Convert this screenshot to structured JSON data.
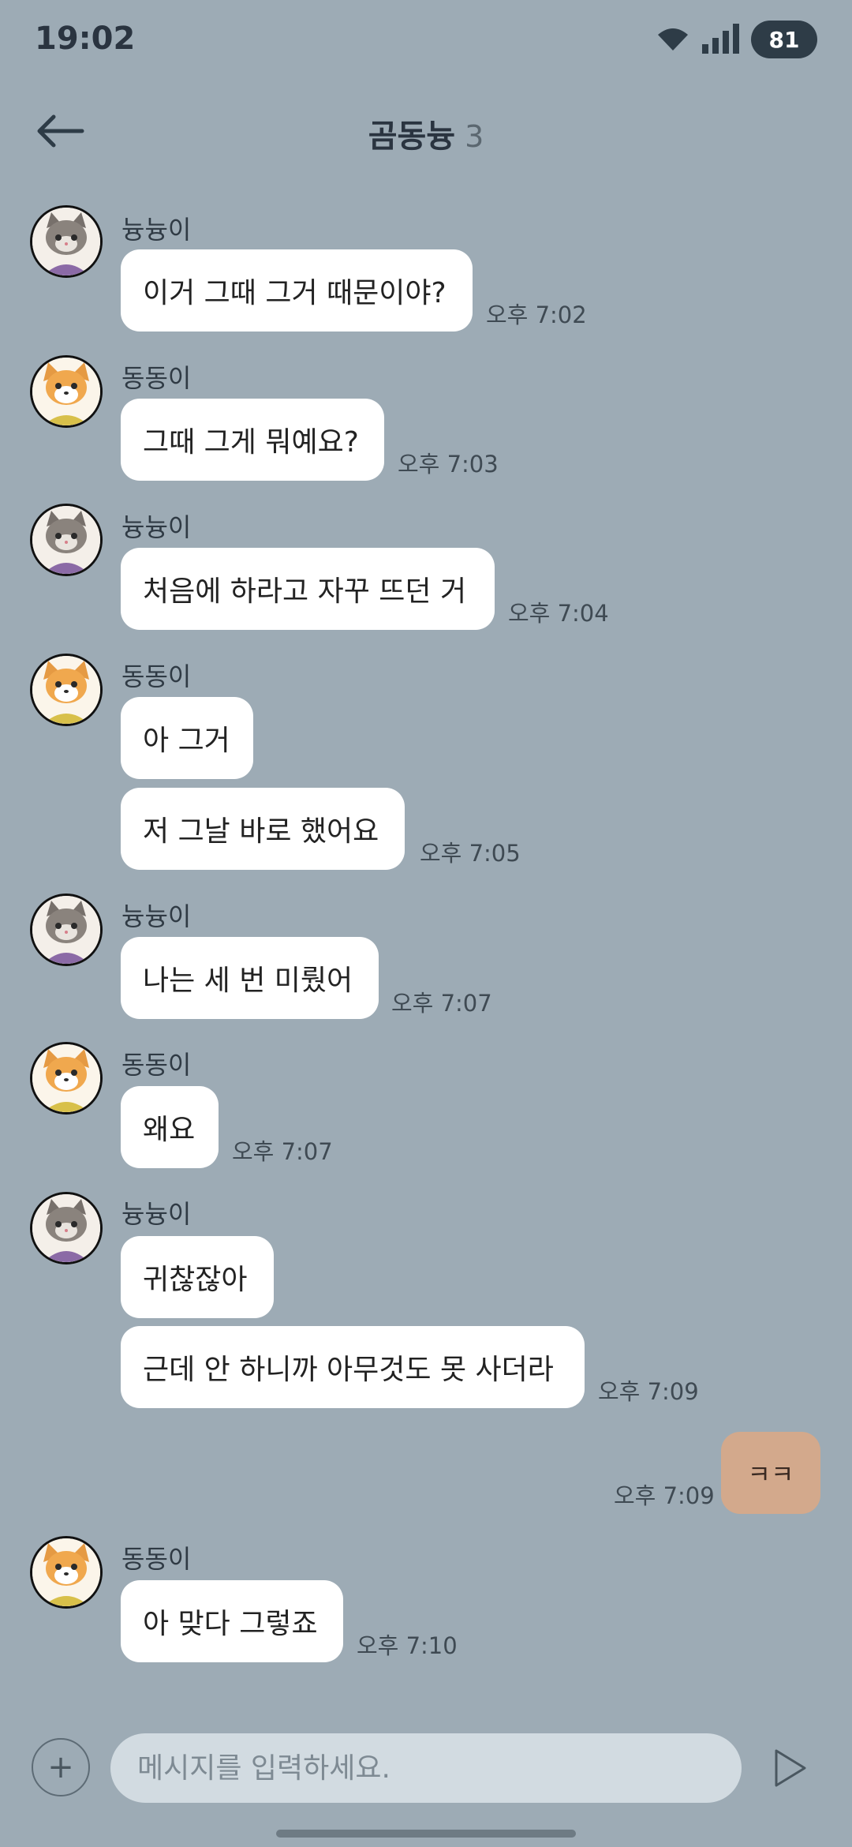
{
  "status": {
    "time": "19:02",
    "battery": "81"
  },
  "header": {
    "title": "곰동늉",
    "member_count": "3"
  },
  "messages": [
    {
      "sender": "늉늉이",
      "text": "이거 그때 그거 때문이야?",
      "time": "오후 7:02"
    },
    {
      "sender": "동동이",
      "text": "그때 그게 뭐예요?",
      "time": "오후 7:03"
    },
    {
      "sender": "늉늉이",
      "text": "처음에 하라고 자꾸 뜨던 거",
      "time": "오후 7:04"
    },
    {
      "sender": "동동이",
      "text": "아 그거"
    },
    {
      "text": "저 그날 바로 했어요",
      "time": "오후 7:05"
    },
    {
      "sender": "늉늉이",
      "text": "나는 세 번 미뤘어",
      "time": "오후 7:07"
    },
    {
      "sender": "동동이",
      "text": "왜요",
      "time": "오후 7:07"
    },
    {
      "sender": "늉늉이",
      "text": "귀찮잖아"
    },
    {
      "text": "근데 안 하니까 아무것도 못 사더라",
      "time": "오후 7:09"
    },
    {
      "sender": "me",
      "text": "ㅋㅋ",
      "time": "오후 7:09"
    },
    {
      "sender": "동동이",
      "text": "아 맞다 그렇죠",
      "time": "오후 7:10"
    }
  ],
  "input": {
    "placeholder": "메시지를 입력하세요.",
    "value": ""
  },
  "icons": {
    "back": "arrow-left-icon",
    "plus": "plus-icon",
    "send": "send-icon",
    "wifi": "wifi-icon",
    "signal": "signal-icon"
  },
  "colors": {
    "background": "#9DABB5",
    "bubble_other": "#FFFFFF",
    "bubble_mine": "#D3A98C",
    "input_bg": "#D2DBE1"
  }
}
